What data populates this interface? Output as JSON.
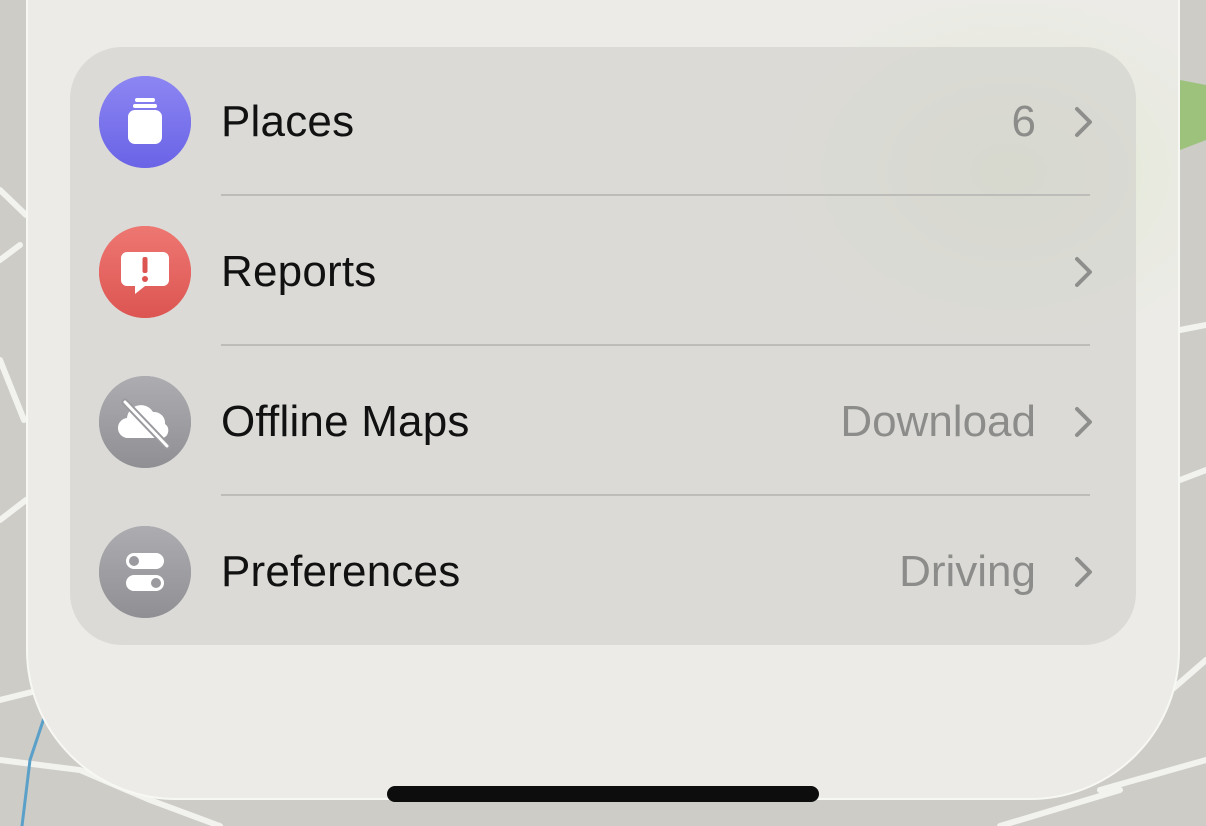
{
  "list": {
    "items": [
      {
        "label": "Places",
        "value": "6",
        "icon": "places-icon",
        "icon_color": "#7a74ee"
      },
      {
        "label": "Reports",
        "value": "",
        "icon": "report-bubble-icon",
        "icon_color": "#e5625e"
      },
      {
        "label": "Offline Maps",
        "value": "Download",
        "icon": "cloud-slash-icon",
        "icon_color": "#9e9ea3"
      },
      {
        "label": "Preferences",
        "value": "Driving",
        "icon": "toggles-icon",
        "icon_color": "#9e9ea3"
      }
    ]
  },
  "colors": {
    "sheet_background": "#ecebe7",
    "card_background": "#d6d5d1",
    "secondary_text": "#8c8c8a",
    "primary_text": "#111111"
  }
}
